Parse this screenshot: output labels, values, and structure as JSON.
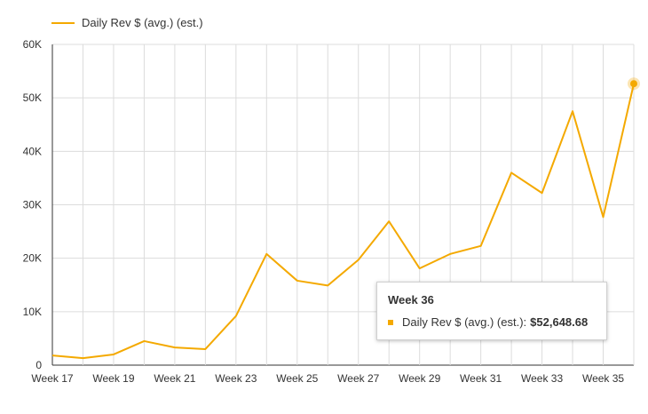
{
  "legend": {
    "label": "Daily Rev $ (avg.) (est.)",
    "color": "#f4a900"
  },
  "tooltip": {
    "title": "Week 36",
    "series_label": "Daily Rev $ (avg.) (est.):",
    "value": "$52,648.68"
  },
  "chart_data": {
    "type": "line",
    "x": [
      "Week 17",
      "Week 18",
      "Week 19",
      "Week 20",
      "Week 21",
      "Week 22",
      "Week 23",
      "Week 24",
      "Week 25",
      "Week 26",
      "Week 27",
      "Week 28",
      "Week 29",
      "Week 30",
      "Week 31",
      "Week 32",
      "Week 33",
      "Week 34",
      "Week 35",
      "Week 36"
    ],
    "x_tick_labels": [
      "Week 17",
      "Week 19",
      "Week 21",
      "Week 23",
      "Week 25",
      "Week 27",
      "Week 29",
      "Week 31",
      "Week 33",
      "Week 35"
    ],
    "series": [
      {
        "name": "Daily Rev $ (avg.) (est.)",
        "color": "#f4a900",
        "values": [
          1800,
          1300,
          2000,
          4500,
          3300,
          3000,
          9200,
          20800,
          15800,
          14900,
          19700,
          26900,
          18100,
          20800,
          22300,
          36000,
          32200,
          47500,
          27700,
          52648.68
        ]
      }
    ],
    "ylim": [
      0,
      60000
    ],
    "y_ticks": [
      "0",
      "10K",
      "20K",
      "30K",
      "40K",
      "50K",
      "60K"
    ],
    "grid": true,
    "legend_position": "top-left",
    "highlighted_point": "Week 36"
  }
}
